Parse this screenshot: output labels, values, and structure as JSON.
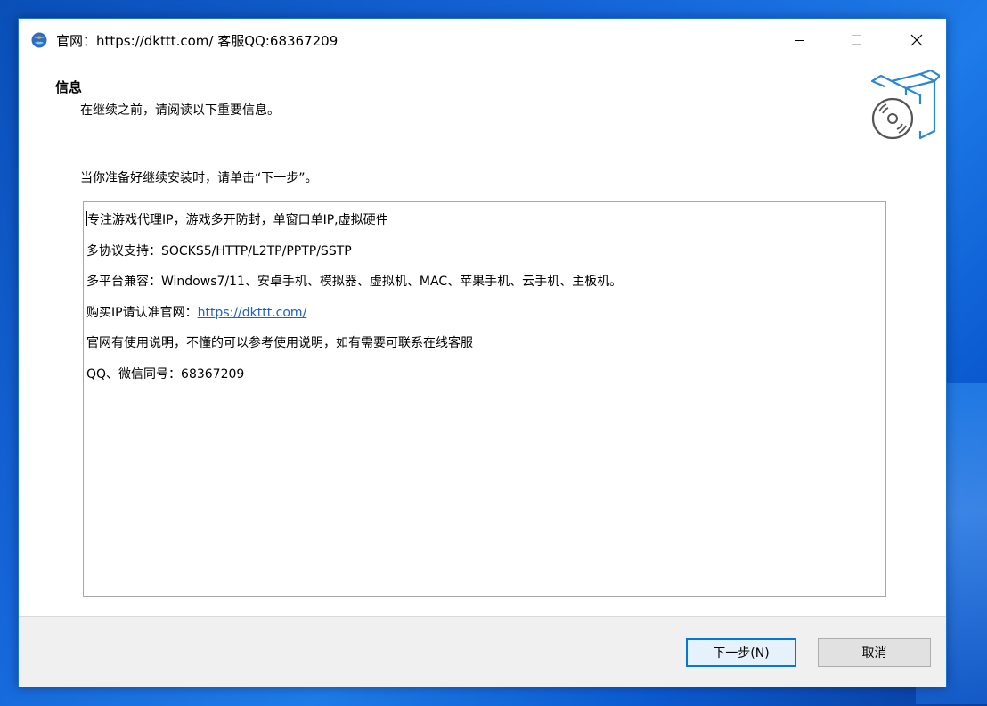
{
  "window": {
    "title": "官网：https://dkttt.com/ 客服QQ:68367209"
  },
  "header": {
    "heading": "信息",
    "subheading": "在继续之前，请阅读以下重要信息。"
  },
  "instruction": "当你准备好继续安装时，请单击“下一步”。",
  "memo": {
    "lines": [
      "专注游戏代理IP，游戏多开防封，单窗口单IP,虚拟硬件",
      "多协议支持：SOCKS5/HTTP/L2TP/PPTP/SSTP",
      "多平台兼容：Windows7/11、安卓手机、模拟器、虚拟机、MAC、苹果手机、云手机、主板机。",
      "购买IP请认准官网：",
      "官网有使用说明，不懂的可以参考使用说明，如有需要可联系在线客服",
      "QQ、微信同号：68367209"
    ],
    "link_text": "https://dkttt.com/"
  },
  "buttons": {
    "next": "下一步(N)",
    "cancel": "取消"
  },
  "colors": {
    "accent": "#0078d7",
    "link": "#1a5fd6",
    "footer_bg": "#f0f0f0"
  }
}
